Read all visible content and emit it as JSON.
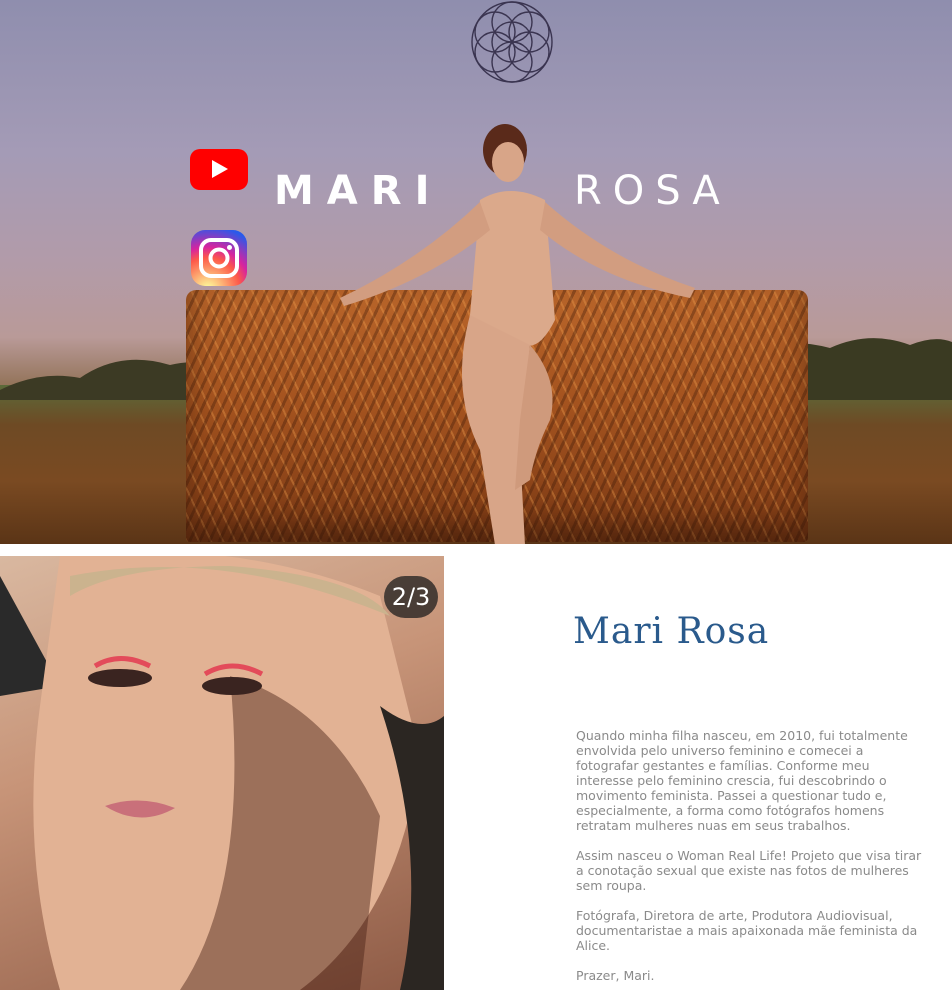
{
  "hero": {
    "title_first": "MARI",
    "title_last": "ROSA",
    "logo_icon": "flower-of-life-icon",
    "social": [
      {
        "name": "youtube",
        "icon": "youtube-icon",
        "color": "#ff0000"
      },
      {
        "name": "instagram",
        "icon": "instagram-icon",
        "color": "#d6249f"
      }
    ]
  },
  "gallery": {
    "counter": "2/3"
  },
  "about": {
    "title": "Mari Rosa",
    "title_color": "#2a5a8c",
    "paragraphs": [
      "Quando minha filha nasceu, em 2010, fui totalmente envolvida pelo universo feminino e comecei a fotografar gestantes e famílias. Conforme meu interesse pelo feminino crescia, fui descobrindo o movimento feminista. Passei a questionar tudo e, especialmente, a forma como fotógrafos homens retratam mulheres nuas em seus trabalhos.",
      "Assim nasceu o Woman Real Life! Projeto que visa tirar a conotação sexual que existe nas fotos de mulheres sem roupa.",
      "Fotógrafa, Diretora de arte, Produtora Audiovisual, documentaristae a mais apaixonada mãe feminista da Alice.",
      "Prazer, Mari."
    ]
  }
}
